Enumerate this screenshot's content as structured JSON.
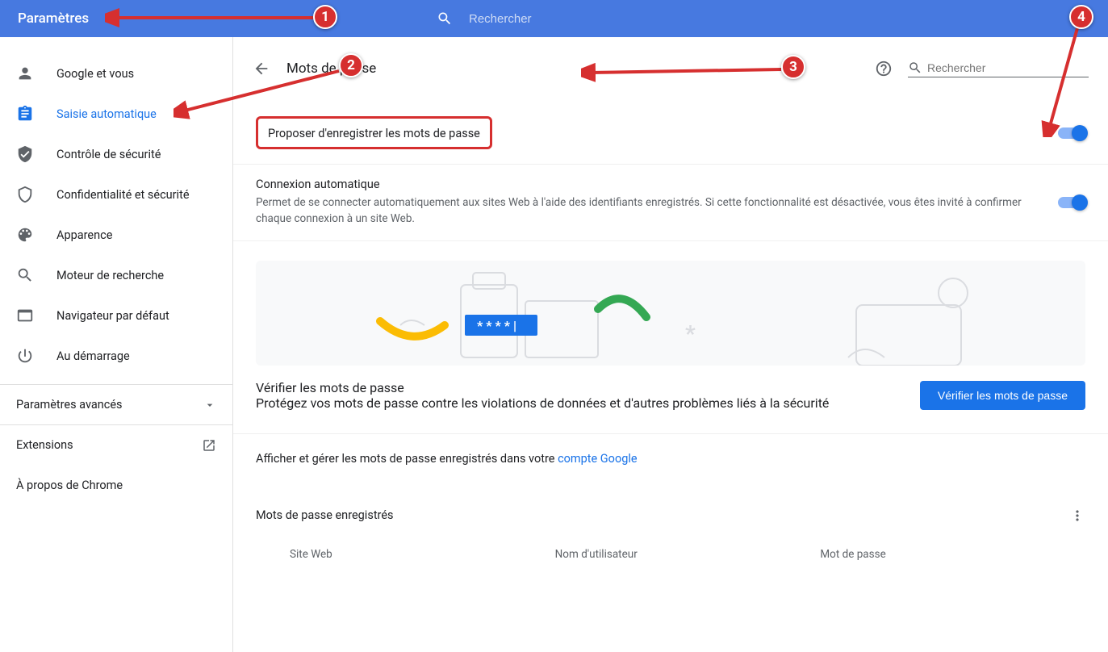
{
  "header": {
    "title": "Paramètres",
    "search_placeholder": "Rechercher"
  },
  "sidebar": {
    "items": [
      {
        "label": "Google et vous",
        "icon": "person-icon"
      },
      {
        "label": "Saisie automatique",
        "icon": "clipboard-icon",
        "active": true
      },
      {
        "label": "Contrôle de sécurité",
        "icon": "shield-check-icon"
      },
      {
        "label": "Confidentialité et sécurité",
        "icon": "shield-icon"
      },
      {
        "label": "Apparence",
        "icon": "palette-icon"
      },
      {
        "label": "Moteur de recherche",
        "icon": "search-icon"
      },
      {
        "label": "Navigateur par défaut",
        "icon": "browser-icon"
      },
      {
        "label": "Au démarrage",
        "icon": "power-icon"
      }
    ],
    "advanced_label": "Paramètres avancés",
    "extensions_label": "Extensions",
    "about_label": "À propos de Chrome"
  },
  "page": {
    "title": "Mots de passe",
    "search_placeholder": "Rechercher",
    "offer_save_label": "Proposer d'enregistrer les mots de passe",
    "auto_signin_label": "Connexion automatique",
    "auto_signin_desc": "Permet de se connecter automatiquement aux sites Web à l'aide des identifiants enregistrés. Si cette fonctionnalité est désactivée, vous êtes invité à confirmer chaque connexion à un site Web.",
    "verify_title": "Vérifier les mots de passe",
    "verify_desc": "Protégez vos mots de passe contre les violations de données et d'autres problèmes liés à la sécurité",
    "verify_button": "Vérifier les mots de passe",
    "manage_text_prefix": "Afficher et gérer les mots de passe enregistrés dans votre ",
    "manage_link": "compte Google",
    "saved_section_title": "Mots de passe enregistrés",
    "table_cols": {
      "site": "Site Web",
      "user": "Nom d'utilisateur",
      "pass": "Mot de passe"
    }
  },
  "annotations": {
    "1": "1",
    "2": "2",
    "3": "3",
    "4": "4"
  }
}
